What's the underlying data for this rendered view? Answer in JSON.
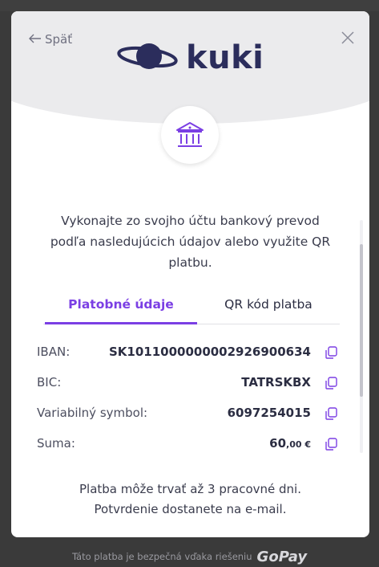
{
  "header": {
    "back_label": "Späť",
    "logo_text": "kuki"
  },
  "instructions": "Vykonajte zo svojho účtu bankový prevod podľa nasledujúcich údajov alebo využite QR platbu.",
  "tabs": [
    {
      "label": "Platobné údaje",
      "active": true
    },
    {
      "label": "QR kód platba",
      "active": false
    }
  ],
  "details": {
    "iban": {
      "label": "IBAN:",
      "value": "SK1011000000002926900634"
    },
    "bic": {
      "label": "BIC:",
      "value": "TATRSKBX"
    },
    "vs": {
      "label": "Variabilný symbol:",
      "value": "6097254015"
    },
    "amount": {
      "label": "Suma:",
      "value_main": "60",
      "value_decimal": ",00 €"
    }
  },
  "footer": {
    "line1": "Platba môže trvať až 3 pracovné dni.",
    "line2": "Potvrdenie dostanete na e-mail."
  },
  "secure": {
    "text": "Táto platba je bezpečná vďaka riešeniu",
    "brand": "GoPay"
  },
  "colors": {
    "accent": "#7b3fe4",
    "brand_dark": "#2b2d5c"
  },
  "icons": [
    "arrow-left-icon",
    "close-icon",
    "planet-logo-icon",
    "bank-icon",
    "copy-icon"
  ]
}
